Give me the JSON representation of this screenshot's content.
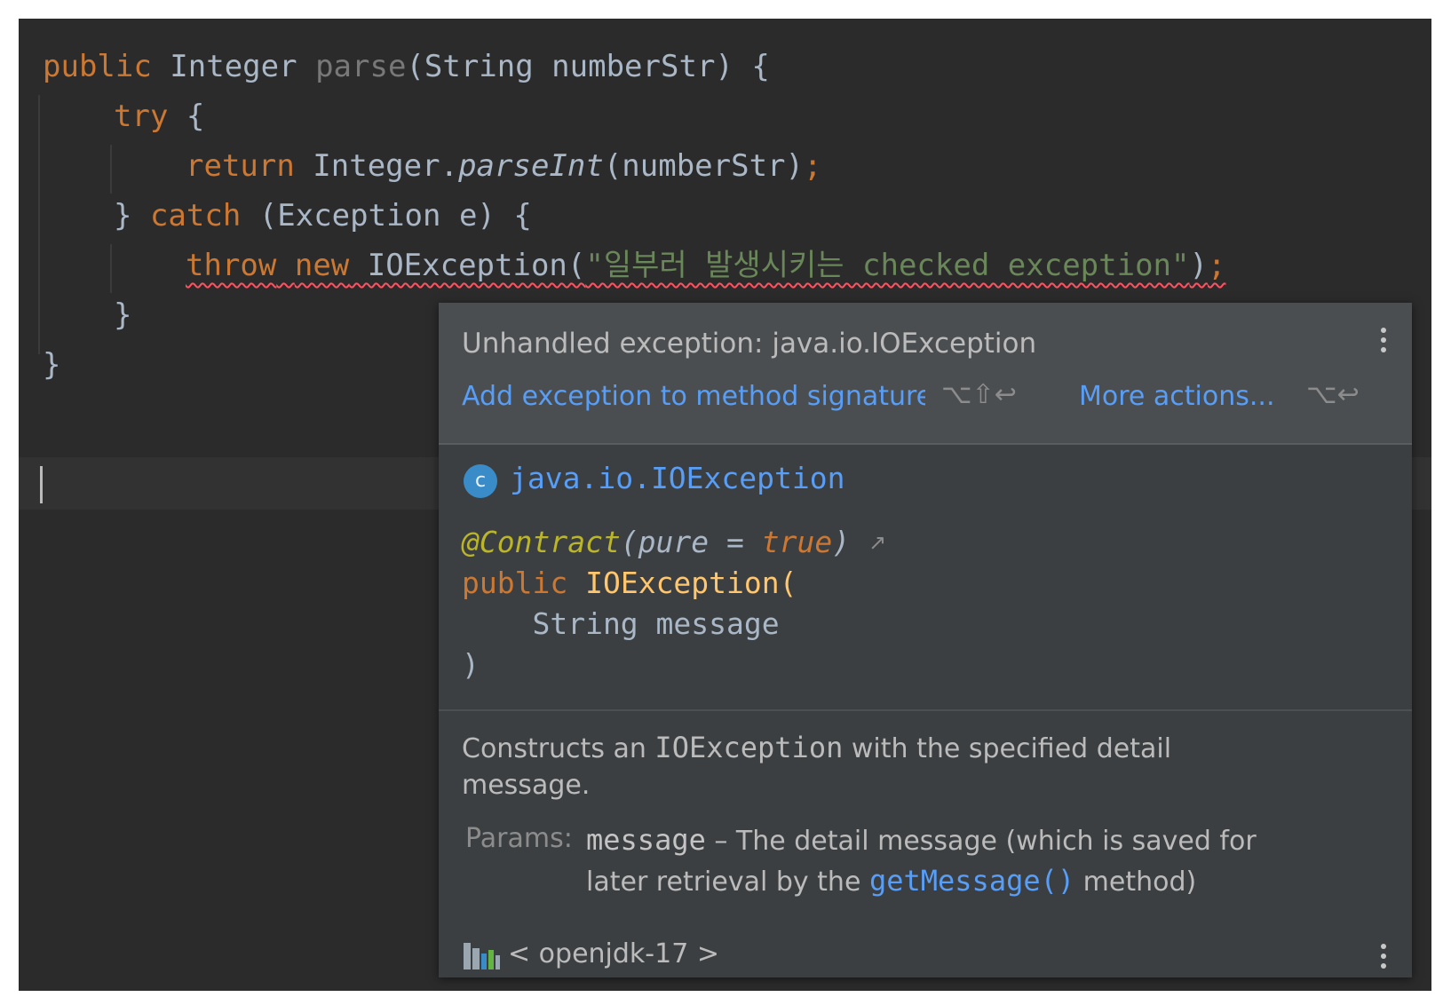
{
  "editor": {
    "lines": [
      {
        "kw": "public",
        "t1": " Integer ",
        "fn": "parse",
        "t2": "(String numberStr) {"
      },
      {
        "kw": "try",
        "t1": " {"
      },
      {
        "kw": "return",
        "t1": " Integer.",
        "it": "parseInt",
        "t2": "(numberStr)",
        "semi": ";"
      },
      {
        "t0": "} ",
        "kw": "catch",
        "t1": " (Exception e) {"
      },
      {
        "kw1": "throw",
        "kw2": "new",
        "t1": " IOException(",
        "str": "\"일부러 발생시키는 checked exception\"",
        "t2": ")",
        "semi": ";"
      },
      {
        "t0": "}"
      },
      {
        "t0": "}"
      }
    ]
  },
  "popup": {
    "error": "Unhandled exception: java.io.IOException",
    "fix_action": "Add exception to method signature",
    "fix_shortcut": "⌥⇧↩",
    "more_actions": "More actions...",
    "more_shortcut": "⌥↩",
    "class_icon_letter": "c",
    "class_name": "java.io.IOException",
    "annotation": "@Contract",
    "annotation_args_open": "(pure = ",
    "annotation_value": "true",
    "annotation_args_close": ")",
    "external_link": "↗",
    "sig_kw": "public",
    "sig_name": "IOException(",
    "sig_param": "    String message",
    "sig_close": ")",
    "desc_prefix": "Constructs an ",
    "desc_code": "IOException",
    "desc_suffix": " with the specified detail",
    "desc_line2": "message.",
    "params_label": "Params:",
    "param_name": "message",
    "param_desc": " – The detail message (which is saved for",
    "param_line2_prefix": "later retrieval by the ",
    "param_link": "getMessage()",
    "param_line2_suffix": " method)",
    "library": "< openjdk-17 >"
  },
  "colors": {
    "editor_bg": "#2b2b2b",
    "keyword": "#cc7832",
    "string": "#6a8759",
    "error_underline": "#ff5261",
    "link": "#589df6",
    "popup_bg": "#3c3f41"
  }
}
